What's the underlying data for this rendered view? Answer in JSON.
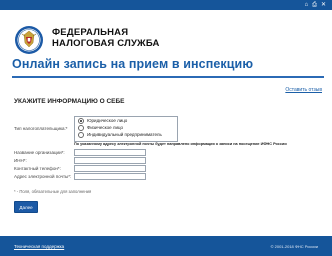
{
  "header": {
    "brand_line1": "ФЕДЕРАЛЬНАЯ",
    "brand_line2": "НАЛОГОВАЯ СЛУЖБА",
    "top_icons": [
      "home-icon",
      "print-icon",
      "close-icon"
    ]
  },
  "page_title": "Онлайн запись на прием в инспекцию",
  "feedback_link": "Оставить отзыв",
  "section_title": "УКАЖИТЕ ИНФОРМАЦИЮ О СЕБЕ",
  "form": {
    "taxpayer_type_label": "Тип налогоплательщика:*",
    "taxpayer_types": [
      {
        "label": "Юридическое лицо",
        "checked": true
      },
      {
        "label": "Физическое лицо",
        "checked": false
      },
      {
        "label": "Индивидуальный предприниматель",
        "checked": false
      }
    ],
    "notice": "По указанному адресу электронной почты будет направлено информация о записи на посещение ИФНС России",
    "fields": [
      {
        "label": "Название организации*:",
        "value": ""
      },
      {
        "label": "ИНН*:",
        "value": ""
      },
      {
        "label": "Контактный телефон*:",
        "value": ""
      },
      {
        "label": "Адрес электронной почты*:",
        "value": ""
      }
    ],
    "required_note": "* - Поля, обязательные для заполнения",
    "submit_label": "Далее"
  },
  "footer": {
    "link": "Техническая поддержка",
    "copyright": "© 2001-2018 ФНС России"
  },
  "colors": {
    "brand_blue": "#15559a",
    "title_blue": "#1b5fa8"
  }
}
